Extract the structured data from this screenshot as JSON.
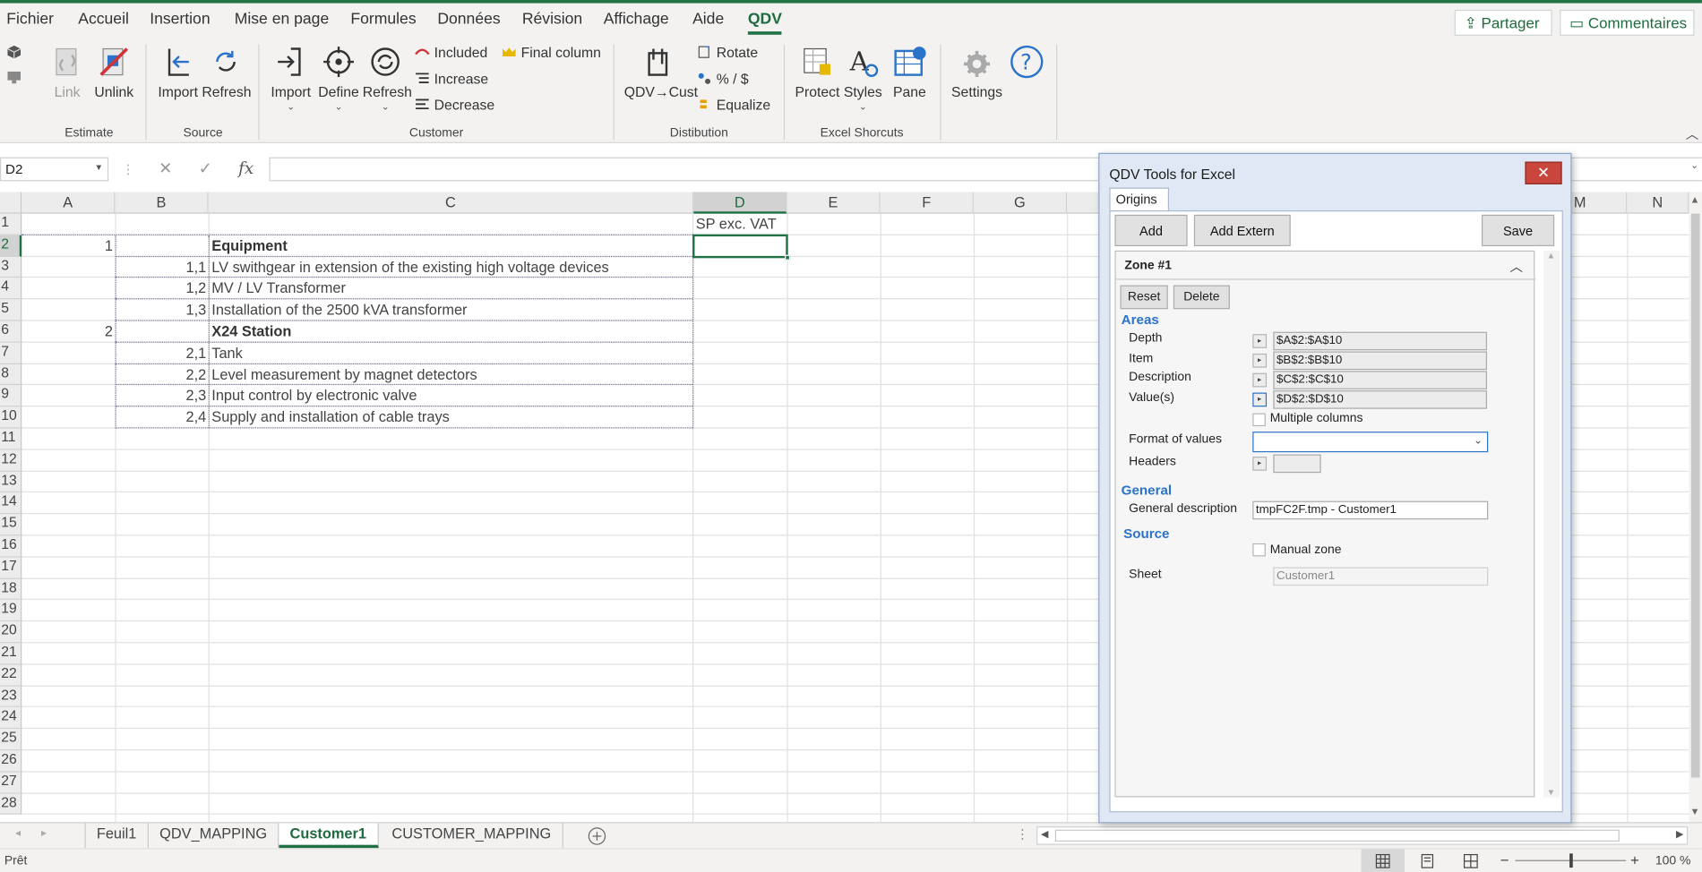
{
  "menu": {
    "tabs": [
      "Fichier",
      "Accueil",
      "Insertion",
      "Mise en page",
      "Formules",
      "Données",
      "Révision",
      "Affichage",
      "Aide",
      "QDV"
    ],
    "active_tab": "QDV",
    "share": "Partager",
    "comments": "Commentaires"
  },
  "ribbon": {
    "estimate": {
      "label": "Estimate",
      "link": "Link",
      "unlink": "Unlink"
    },
    "source": {
      "label": "Source",
      "import": "Import",
      "refresh": "Refresh"
    },
    "customer": {
      "label": "Customer",
      "import": "Import",
      "define": "Define",
      "refresh": "Refresh",
      "included": "Included",
      "increase": "Increase",
      "decrease": "Decrease",
      "final_column": "Final column"
    },
    "distribution": {
      "label": "Distibution",
      "qdv_cust": "QDV→Cust",
      "rotate": "Rotate",
      "percent_dollar": "% / $",
      "equalize": "Equalize"
    },
    "excel_shortcuts": {
      "label": "Excel Shorcuts",
      "protect": "Protect",
      "styles": "Styles",
      "pane": "Pane"
    },
    "settings": "Settings",
    "colors": {
      "accent": "#217346",
      "icon_blue": "#2a73c8",
      "icon_red": "#d13438"
    }
  },
  "formula_bar": {
    "name_box": "D2",
    "fx": "fx",
    "cancel": "✕",
    "enter": "✓",
    "formula": ""
  },
  "sheet": {
    "columns": [
      "A",
      "B",
      "C",
      "D",
      "E",
      "F",
      "G",
      "M",
      "N"
    ],
    "selected_column": "D",
    "rows": [
      "1",
      "2",
      "3",
      "4",
      "5",
      "6",
      "7",
      "8",
      "9",
      "10",
      "11",
      "12",
      "13",
      "14",
      "15",
      "16",
      "17",
      "18",
      "19",
      "20",
      "21",
      "22",
      "23",
      "24",
      "25",
      "26",
      "27",
      "28"
    ],
    "selected_row": "2",
    "d1": "SP exc. VAT",
    "data": [
      {
        "a": "1",
        "b": "",
        "c": "Equipment",
        "bold": true
      },
      {
        "a": "",
        "b": "1,1",
        "c": "LV swithgear in extension of the existing high voltage devices",
        "bold": false
      },
      {
        "a": "",
        "b": "1,2",
        "c": "MV / LV Transformer",
        "bold": false
      },
      {
        "a": "",
        "b": "1,3",
        "c": "Installation of the 2500 kVA transformer",
        "bold": false
      },
      {
        "a": "2",
        "b": "",
        "c": "X24 Station",
        "bold": true
      },
      {
        "a": "",
        "b": "2,1",
        "c": "Tank",
        "bold": false
      },
      {
        "a": "",
        "b": "2,2",
        "c": "Level measurement by magnet detectors",
        "bold": false
      },
      {
        "a": "",
        "b": "2,3",
        "c": "Input control by electronic valve",
        "bold": false
      },
      {
        "a": "",
        "b": "2,4",
        "c": "Supply and installation of cable trays",
        "bold": false
      }
    ]
  },
  "sheet_tabs": {
    "items": [
      "Feuil1",
      "QDV_MAPPING",
      "Customer1",
      "CUSTOMER_MAPPING"
    ],
    "active": "Customer1"
  },
  "status": {
    "ready": "Prêt",
    "zoom": "100 %"
  },
  "dialog": {
    "title": "QDV Tools for Excel",
    "close": "✕",
    "tab": "Origins",
    "add": "Add",
    "add_extern": "Add Extern",
    "save": "Save",
    "zone_title": "Zone #1",
    "reset": "Reset",
    "delete": "Delete",
    "areas_title": "Areas",
    "depth_label": "Depth",
    "depth_value": "$A$2:$A$10",
    "item_label": "Item",
    "item_value": "$B$2:$B$10",
    "description_label": "Description",
    "description_value": "$C$2:$C$10",
    "values_label": "Value(s)",
    "values_value": "$D$2:$D$10",
    "multiple_columns": "Multiple columns",
    "format_label": "Format of values",
    "format_value": "",
    "headers_label": "Headers",
    "headers_value": "",
    "general_title": "General",
    "general_desc_label": "General description",
    "general_desc_value": "tmpFC2F.tmp - Customer1",
    "source_title": "Source",
    "manual_zone": "Manual zone",
    "sheet_label": "Sheet",
    "sheet_value": "Customer1"
  }
}
